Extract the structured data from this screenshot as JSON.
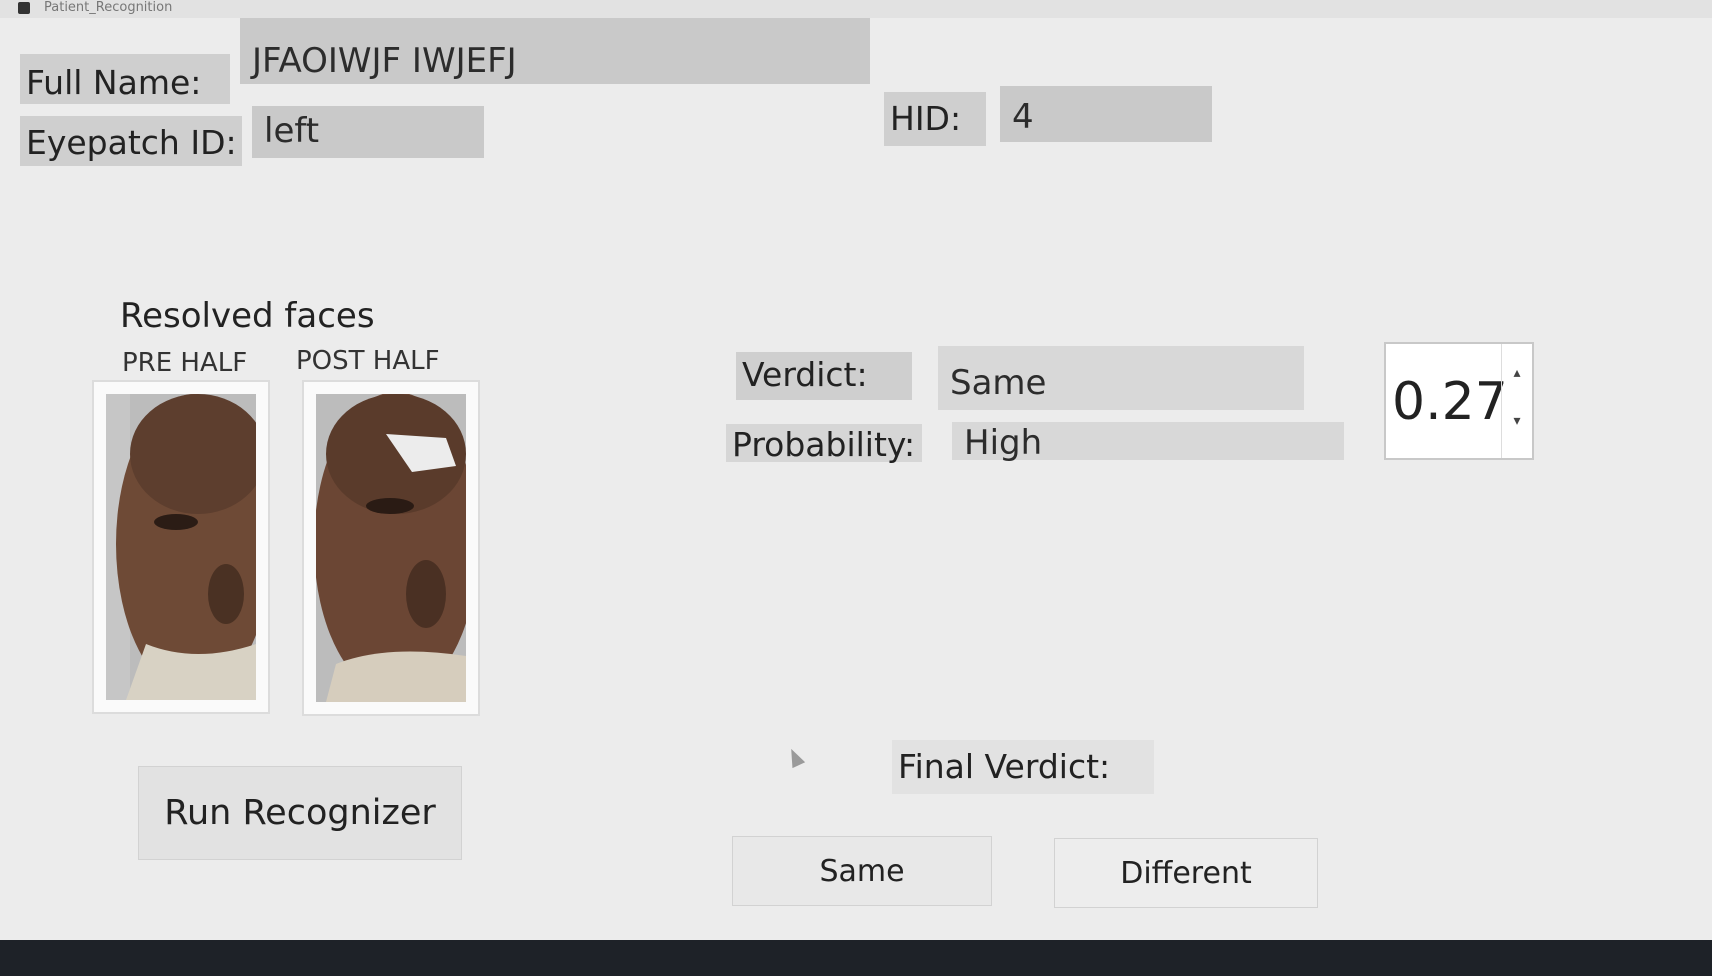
{
  "window": {
    "title": "Patient_Recognition"
  },
  "patient": {
    "full_name_label": "Full Name:",
    "full_name_value": "JFAOIWJF IWJEFJ",
    "eyepatch_label": "Eyepatch ID:",
    "eyepatch_value": "left",
    "hid_label": "HID:",
    "hid_value": "4"
  },
  "faces": {
    "section_title": "Resolved faces",
    "pre_label": "PRE HALF",
    "post_label": "POST HALF"
  },
  "result": {
    "verdict_label": "Verdict:",
    "verdict_value": "Same",
    "probability_label": "Probability:",
    "probability_value": "High",
    "threshold_value": "0.27"
  },
  "actions": {
    "run_label": "Run Recognizer",
    "final_verdict_label": "Final Verdict:",
    "same_label": "Same",
    "different_label": "Different"
  },
  "colors": {
    "window_bg": "#ececec",
    "label_bg": "#cfcfcf",
    "field_bg": "#c9c9c9"
  }
}
